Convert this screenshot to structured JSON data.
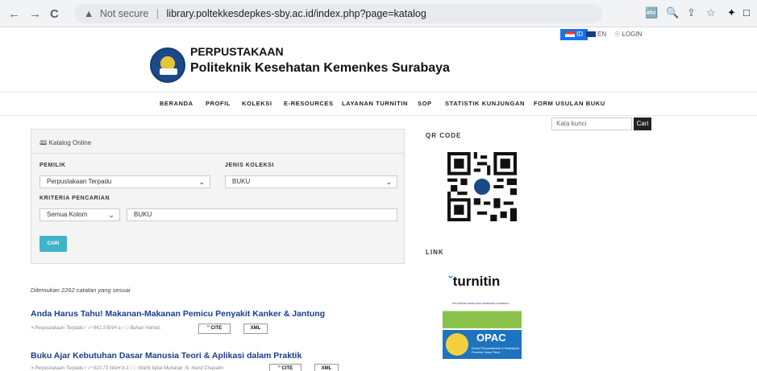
{
  "browser": {
    "back_icon": "←",
    "forward_icon": "→",
    "reload_icon": "C",
    "warning_icon": "▲",
    "security_text": "Not secure",
    "url": "library.poltekkesdepkes-sby.ac.id/index.php?page=katalog",
    "toolbar_icons": [
      "translate-icon",
      "zoom-icon",
      "share-icon",
      "star-icon",
      "extensions-icon",
      "sidepanel-icon"
    ]
  },
  "topbar": {
    "lang_id": "ID",
    "lang_en": "EN",
    "login": "LOGIN"
  },
  "brand": {
    "line1": "PERPUSTAKAAN",
    "line2": "Politeknik Kesehatan Kemenkes Surabaya"
  },
  "nav": [
    "BERANDA",
    "PROFIL",
    "KOLEKSI",
    "E-RESOURCES",
    "LAYANAN TURNITIN",
    "SOP",
    "STATISTIK KUNJUNGAN",
    "FORM USULAN BUKU"
  ],
  "search": {
    "placeholder": "Kata kunci",
    "button": "Cari"
  },
  "catalog": {
    "heading": "Katalog Online",
    "pemilik_label": "PEMILIK",
    "pemilik_value": "Perpustakaan Terpadu",
    "jenis_label": "JENIS KOLEKSI",
    "jenis_value": "BUKU",
    "kriteria_label": "KRITERIA PENCARIAN",
    "kriteria_value": "Semua Kolom",
    "query_value": "BUKU",
    "cari_button": "CARI"
  },
  "sidebar": {
    "qr_title": "QR CODE",
    "link_title": "LINK",
    "turnitin": "turnitin",
    "opac": "OPAC",
    "opac_sub": "Dinas Perpustakaan & Kearsipan Provinsi Jawa Timur",
    "lib_sub": "POLITEKNIK KESEHATAN KEMENKES SURABAYA"
  },
  "results": {
    "found_text": "Ditemukan 2262 catatan yang sesuai",
    "items": [
      {
        "title": "Anda Harus Tahu! Makanan-Makanan Pemicu Penyakit Kanker & Jantung",
        "location": "Perpustakaan Terpadu",
        "callno": "641.3 BAH a",
        "author": "Bahari Hamid,",
        "cite": "CITE",
        "xml": "XML"
      },
      {
        "title": "Buku Ajar Kebutuhan Dasar Manusia Teori & Aplikasi dalam Praktik",
        "location": "Perpustakaan Terpadu",
        "callno": "610.73 WAH b-1",
        "author": "Wahit Iqbal Mubarak ,N. Nurul Chayatin",
        "cite": "CITE",
        "xml": "XML"
      }
    ]
  }
}
